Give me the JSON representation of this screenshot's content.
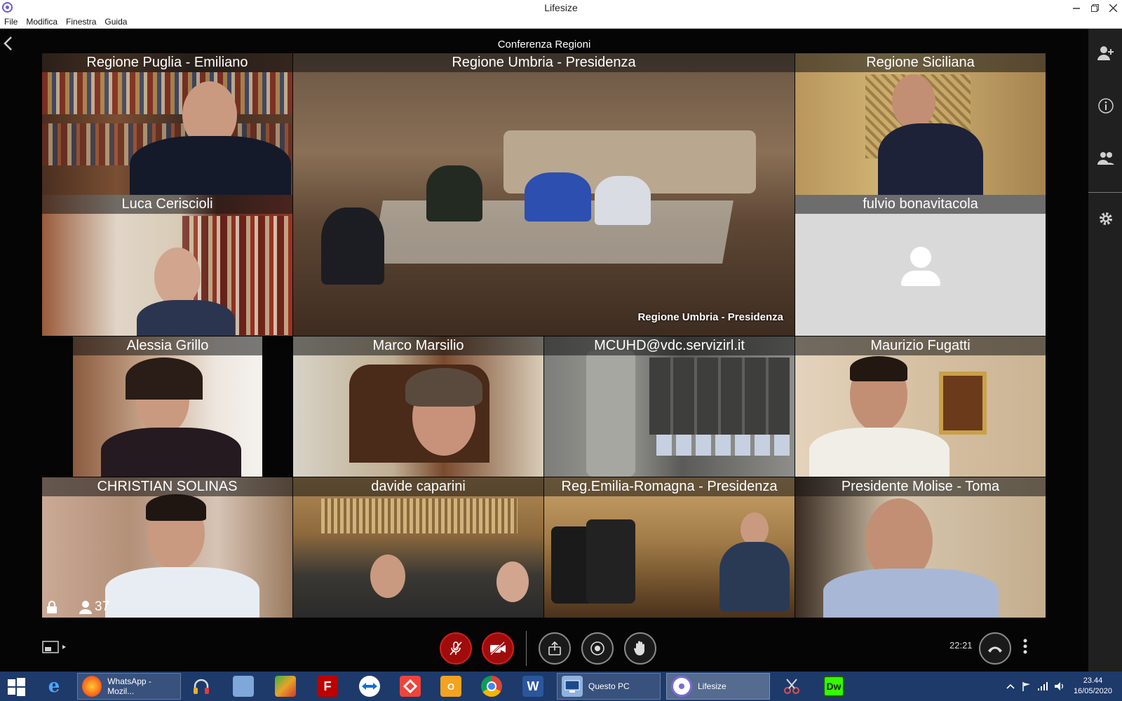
{
  "window": {
    "title": "Lifesize"
  },
  "menu": [
    "File",
    "Modifica",
    "Finestra",
    "Guida"
  ],
  "conference": {
    "title": "Conferenza Regioni"
  },
  "tiles": [
    {
      "label": "Regione Puglia - Emiliano"
    },
    {
      "label": "Regione Umbria - Presidenza",
      "overlay": "Regione Umbria - Presidenza"
    },
    {
      "label": "Regione Siciliana"
    },
    {
      "label": "Luca Ceriscioli"
    },
    {
      "label": "fulvio bonavitacola"
    },
    {
      "label": "Alessia Grillo"
    },
    {
      "label": "Marco Marsilio"
    },
    {
      "label": "MCUHD@vdc.servizirl.it"
    },
    {
      "label": "Maurizio Fugatti"
    },
    {
      "label": "CHRISTIAN SOLINAS"
    },
    {
      "label": "davide caparini"
    },
    {
      "label": "Reg.Emilia-Romagna - Presidenza"
    },
    {
      "label": "Presidente Molise - Toma"
    }
  ],
  "status": {
    "participant_count": "37"
  },
  "call": {
    "duration": "22:21"
  },
  "rail_icons": [
    "add-participant-icon",
    "info-icon",
    "participants-icon",
    "settings-icon"
  ],
  "controls": [
    "mute-microphone",
    "mute-camera",
    "share-screen",
    "record",
    "raise-hand",
    "hang-up"
  ],
  "taskbar": {
    "apps": [
      {
        "label": "WhatsApp - Mozil..."
      },
      {
        "label": "Questo PC"
      },
      {
        "label": "Lifesize"
      }
    ],
    "clock_time": "23.44",
    "clock_date": "16/05/2020"
  },
  "colors": {
    "red_control": "#a00c0c",
    "taskbar": "#1d3a6b",
    "rail": "#202020"
  }
}
